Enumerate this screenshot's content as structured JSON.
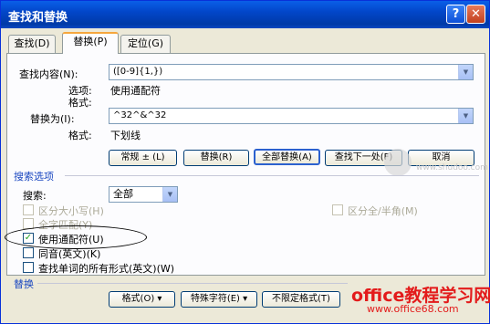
{
  "window": {
    "title": "查找和替换",
    "help": "?",
    "close": "✕"
  },
  "tabs": [
    {
      "label": "查找(D)"
    },
    {
      "label": "替换(P)"
    },
    {
      "label": "定位(G)"
    }
  ],
  "find": {
    "label": "查找内容(N):",
    "value": "([0-9]{1,})",
    "options_label": "选项:",
    "options_value": "使用通配符",
    "format_label": "格式:",
    "format_value": ""
  },
  "replace": {
    "label": "替换为(I):",
    "value": "^32^&^32",
    "format_label": "格式:",
    "format_value": "下划线"
  },
  "buttons": {
    "normal": "常规 ± (L)",
    "replace": "替换(R)",
    "replace_all": "全部替换(A)",
    "find_next": "查找下一处(F)",
    "cancel": "取消"
  },
  "search_options": {
    "title": "搜索选项",
    "search_label": "搜索:",
    "search_value": "全部",
    "match_case": "区分大小写(H)",
    "whole_word": "全字匹配(Y)",
    "wildcards": "使用通配符(U)",
    "sounds_like": "同音(英文)(K)",
    "all_forms": "查找单词的所有形式(英文)(W)",
    "half_full": "区分全/半角(M)"
  },
  "replace_section": {
    "title": "替换",
    "format": "格式(O) ▾",
    "special": "特殊字符(E) ▾",
    "no_format": "不限定格式(T)"
  },
  "watermark": {
    "brand": "office教程学习网",
    "url": "www.office68.com",
    "site": "www.shudoo.com"
  },
  "checked": {
    "wildcards": "✓"
  }
}
